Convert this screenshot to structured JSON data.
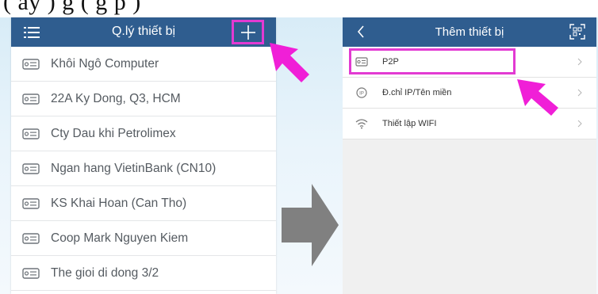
{
  "caption": {
    "text": "(   ấy   )                                g  ( g  p  )"
  },
  "left_screen": {
    "title": "Q.lý thiết bị",
    "devices": [
      {
        "name": "Khôi Ngô Computer"
      },
      {
        "name": "22A Ky Dong, Q3, HCM"
      },
      {
        "name": "Cty Dau khi Petrolimex"
      },
      {
        "name": "Ngan hang VietinBank (CN10)"
      },
      {
        "name": "KS Khai Hoan (Can Tho)"
      },
      {
        "name": "Coop Mark Nguyen Kiem"
      },
      {
        "name": "The gioi di dong 3/2"
      }
    ]
  },
  "right_screen": {
    "title": "Thêm thiết bị",
    "options": [
      {
        "label": "P2P",
        "icon": "p2p-device-icon"
      },
      {
        "label": "Đ.chỉ IP/Tên miền",
        "icon": "ip-address-icon"
      },
      {
        "label": "Thiết lập WIFI",
        "icon": "wifi-icon"
      }
    ]
  },
  "colors": {
    "app_bar": "#2f5d8f",
    "highlight": "#e23ad2",
    "arrow": "#808080",
    "background": "#d8ecf7"
  }
}
